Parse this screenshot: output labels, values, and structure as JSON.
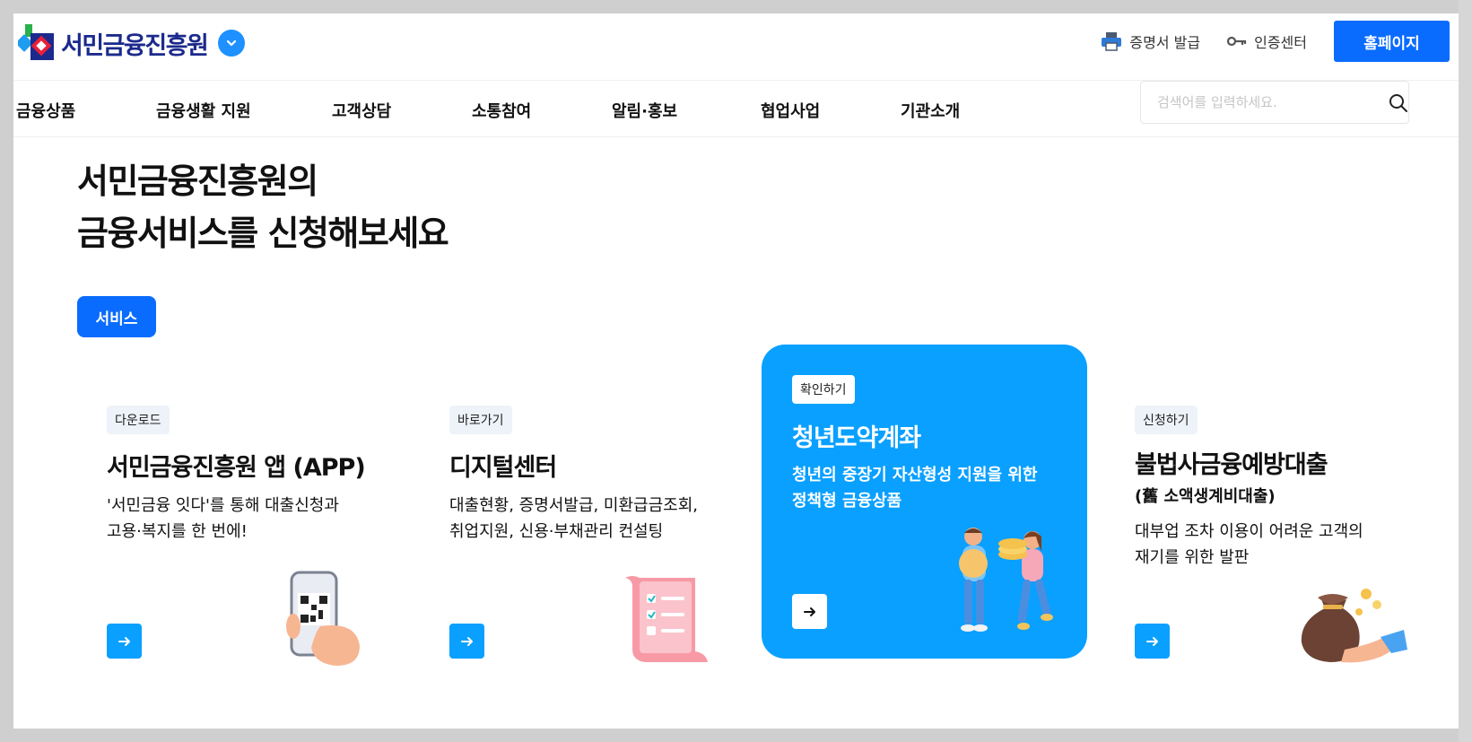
{
  "header": {
    "logo_text": "서민금융진흥원",
    "util_links": [
      {
        "label": "증명서 발급",
        "icon": "printer-icon"
      },
      {
        "label": "인증센터",
        "icon": "key-icon"
      }
    ],
    "home_button": "홈페이지"
  },
  "nav": {
    "items": [
      "금융상품",
      "금융생활 지원",
      "고객상담",
      "소통참여",
      "알림·홍보",
      "협업사업",
      "기관소개"
    ],
    "search_placeholder": "검색어를 입력하세요."
  },
  "hero": {
    "title_line1": "서민금융진흥원의",
    "title_line2": "금융서비스를 신청해보세요",
    "tab_label": "서비스"
  },
  "cards": [
    {
      "badge": "다운로드",
      "title": "서민금융진흥원 앱 (APP)",
      "desc1": "'서민금융 잇다'를 통해 대출신청과",
      "desc2": "고용·복지를 한 번에!",
      "illustration": "phone-qr-illustration"
    },
    {
      "badge": "바로가기",
      "title": "디지털센터",
      "desc1": "대출현황, 증명서발급, 미환급금조회,",
      "desc2": "취업지원, 신용·부채관리 컨설팅",
      "illustration": "document-checklist-illustration"
    },
    {
      "badge": "확인하기",
      "title": "청년도약계좌",
      "desc1": "청년의 중장기 자산형성 지원을 위한",
      "desc2": "정책형 금융상품",
      "illustration": "young-couple-coins-illustration"
    },
    {
      "badge": "신청하기",
      "title": "불법사금융예방대출",
      "subtitle": "(舊 소액생계비대출)",
      "desc1": "대부업 조차 이용이 어려운 고객의",
      "desc2": "재기를 위한 발판",
      "illustration": "money-bag-hand-illustration"
    }
  ],
  "colors": {
    "primary": "#0a6cff",
    "card_active": "#0aa0ff",
    "logo_navy": "#1b2a8c"
  }
}
